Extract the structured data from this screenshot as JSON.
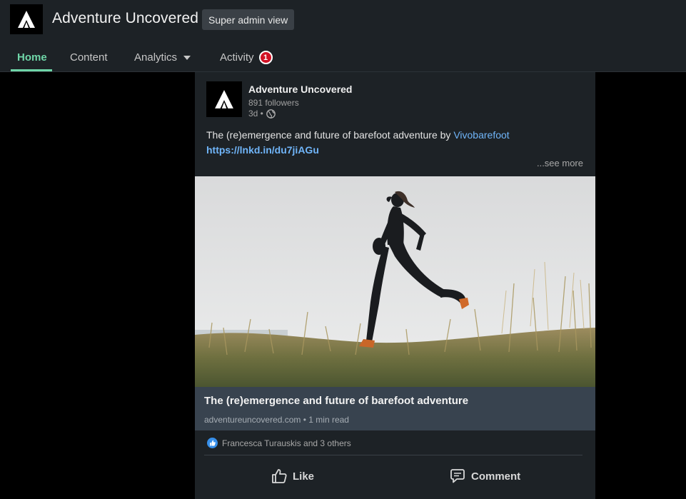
{
  "header": {
    "brand_name": "Adventure Uncovered",
    "admin_badge": "Super admin view",
    "logo_icon": "adventure-uncovered-logo"
  },
  "nav": {
    "items": [
      {
        "label": "Home",
        "active": true
      },
      {
        "label": "Content",
        "active": false
      },
      {
        "label": "Analytics",
        "active": false,
        "dropdown": true
      },
      {
        "label": "Activity",
        "active": false,
        "badge": "1"
      }
    ]
  },
  "post": {
    "author": "Adventure Uncovered",
    "followers": "891 followers",
    "age": "3d •",
    "visibility_icon": "globe-icon",
    "text_prefix": "The (re)emergence and future of barefoot adventure by ",
    "mention": "Vivobarefoot",
    "url": "https://lnkd.in/du7jiAGu",
    "see_more": "...see more",
    "article_title": "The (re)emergence and future of barefoot adventure",
    "article_source": "adventureuncovered.com • 1 min read",
    "reactions_text": "Francesca Turauskis and 3 others",
    "like_label": "Like",
    "comment_label": "Comment"
  },
  "colors": {
    "accent": "#6fd6a8",
    "link": "#70b5f9",
    "notification": "#d11124",
    "surface": "#1d2226"
  }
}
